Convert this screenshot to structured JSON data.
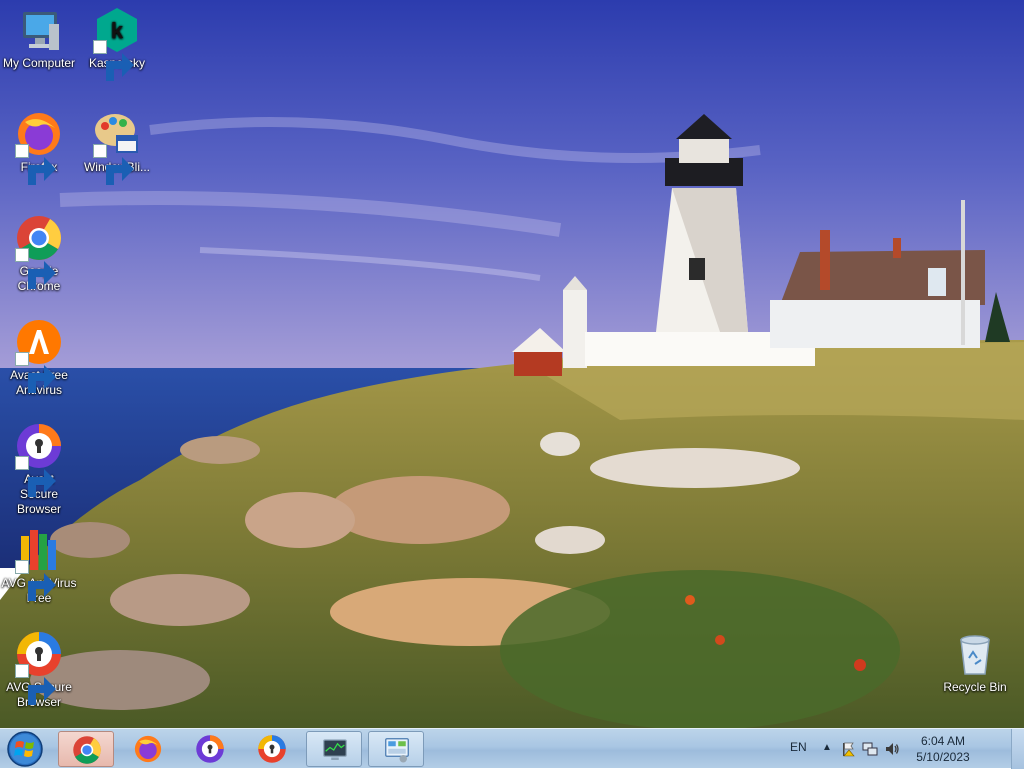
{
  "desktop": {
    "icons": [
      {
        "label": "My Computer",
        "icon": "computer-icon"
      },
      {
        "label": "Kaspersky",
        "icon": "kaspersky-icon"
      },
      {
        "label": "Firefox",
        "icon": "firefox-icon"
      },
      {
        "label": "WindowBli...",
        "icon": "windowblinds-icon"
      },
      {
        "label": "Google Chrome",
        "icon": "chrome-icon"
      },
      {
        "label": "Avast Free Antivirus",
        "icon": "avast-icon"
      },
      {
        "label": "Avast Secure Browser",
        "icon": "avast-browser-icon"
      },
      {
        "label": "AVG AntiVirus Free",
        "icon": "avg-icon"
      },
      {
        "label": "AVG Secure Browser",
        "icon": "avg-browser-icon"
      },
      {
        "label": "Recycle Bin",
        "icon": "recycle-bin-icon"
      }
    ]
  },
  "taskbar": {
    "start_icon": "windows-start-icon",
    "items": [
      {
        "icon": "chrome-icon",
        "state": "active"
      },
      {
        "icon": "firefox-icon",
        "state": "pinned"
      },
      {
        "icon": "avast-browser-icon",
        "state": "pinned"
      },
      {
        "icon": "avg-browser-icon",
        "state": "pinned"
      },
      {
        "icon": "task-manager-icon",
        "state": "open"
      },
      {
        "icon": "control-panel-icon",
        "state": "open"
      }
    ],
    "tray": {
      "language": "EN",
      "time": "6:04 AM",
      "date": "5/10/2023"
    }
  },
  "colors": {
    "taskbar_bg": "#a9c6e3",
    "sky_top": "#2d3fb0",
    "sea": "#27459a"
  }
}
